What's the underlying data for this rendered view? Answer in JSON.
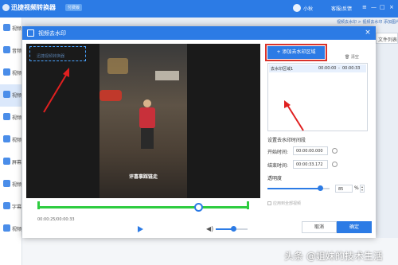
{
  "app": {
    "title": "迅捷视频转换器",
    "badge": "付费版",
    "user": "小秋",
    "feedback": "客服/反馈",
    "window_controls": [
      "≡",
      "—",
      "□",
      "×"
    ],
    "breadcrumb": "视频去水印 > 视频去水印 添加图片/视频水印",
    "right_button": "文件列表",
    "sidebar": [
      {
        "label": "视频转换"
      },
      {
        "label": "音频"
      },
      {
        "label": "视频"
      },
      {
        "label": "视频"
      },
      {
        "label": "视频"
      },
      {
        "label": "视频"
      },
      {
        "label": "屏幕"
      },
      {
        "label": "视频"
      },
      {
        "label": "字幕"
      },
      {
        "label": "视频"
      }
    ],
    "accent": "#2c7be5"
  },
  "modal": {
    "title": "视频去水印",
    "close": "×",
    "preview": {
      "subtitle": "评喜事踩链走",
      "watermark_text": "迅捷视频转换器"
    },
    "timeline": {
      "time": "00:00:25/00:00:33",
      "position": 0.76,
      "volume": 0.55
    },
    "panel": {
      "add_button": "+ 添加去水印区域",
      "clear": "🗑 清空",
      "list": [
        {
          "name": "去水印区域1",
          "start": "00:00:00",
          "end": "00:00:33"
        }
      ],
      "time_section": "设置去水印时间段",
      "start_label": "开始时间:",
      "start_value": "00:00:00.000",
      "end_label": "结束时间:",
      "end_value": "00:00:33.172",
      "opacity_label": "透明度",
      "opacity_value": "85",
      "opacity_unit": "%",
      "opacity": 0.85,
      "apply_all": "应用到全部视频"
    },
    "cancel": "取消",
    "ok": "确定"
  },
  "corner_watermark": "头条 @姐妹的技术生活"
}
